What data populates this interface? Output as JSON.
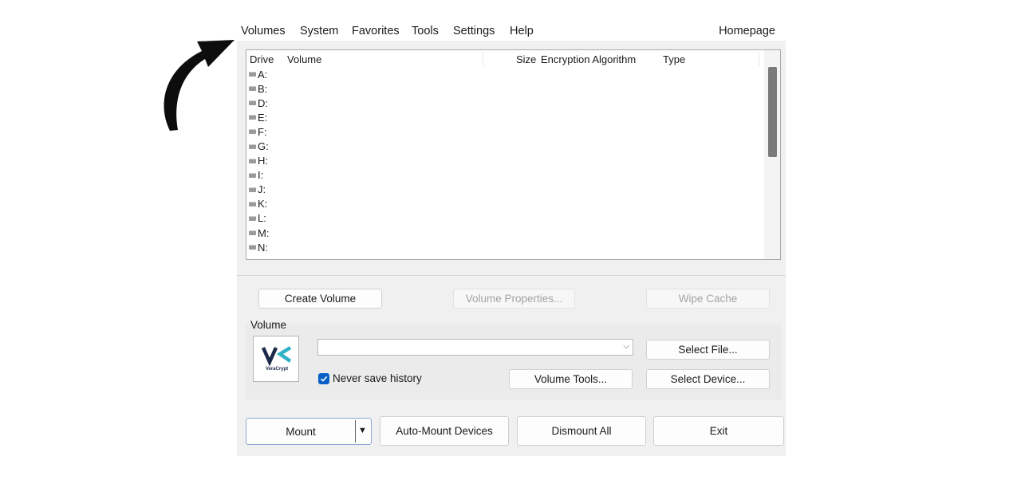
{
  "menubar": {
    "items": [
      "Volumes",
      "System",
      "Favorites",
      "Tools",
      "Settings",
      "Help"
    ],
    "homepage": "Homepage"
  },
  "drive_list": {
    "columns": [
      "Drive",
      "Volume",
      "Size",
      "Encryption Algorithm",
      "Type"
    ],
    "drives": [
      "A:",
      "B:",
      "D:",
      "E:",
      "F:",
      "G:",
      "H:",
      "I:",
      "J:",
      "K:",
      "L:",
      "M:",
      "N:"
    ]
  },
  "actions": {
    "create_volume": "Create Volume",
    "volume_properties": "Volume Properties...",
    "wipe_cache": "Wipe Cache"
  },
  "volume": {
    "label": "Volume",
    "logo_text": "VeraCrypt",
    "path_value": "",
    "never_save_history": "Never save history",
    "never_save_history_checked": true,
    "select_file": "Select File...",
    "volume_tools": "Volume Tools...",
    "select_device": "Select Device..."
  },
  "bottom": {
    "mount": "Mount",
    "auto_mount": "Auto-Mount Devices",
    "dismount_all": "Dismount All",
    "exit": "Exit"
  },
  "colors": {
    "accent": "#0a5fc7",
    "logo_blue": "#1b2a4a",
    "logo_teal": "#2fb1c6"
  },
  "annotation": {
    "icon": "curved-arrow-icon"
  }
}
